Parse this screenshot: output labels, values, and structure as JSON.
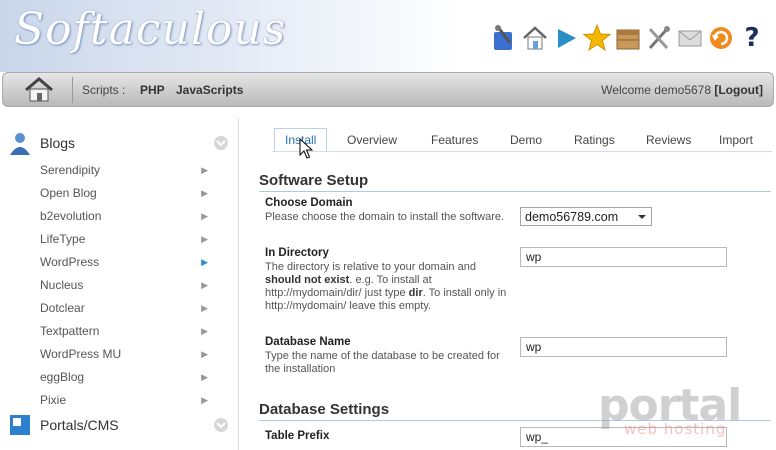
{
  "header": {
    "logo_text": "Softaculous",
    "toolbar_icons": [
      "tools-icon",
      "home-icon",
      "play-icon",
      "star-icon",
      "box-icon",
      "settings-icon",
      "mail-icon",
      "refresh-icon",
      "help-icon"
    ]
  },
  "navbar": {
    "scripts_label": "Scripts :",
    "links": [
      "PHP",
      "JavaScripts"
    ],
    "welcome_text": "Welcome demo5678",
    "logout_label": "[Logout]"
  },
  "sidebar": {
    "categories": [
      {
        "label": "Blogs",
        "icon": "user-icon"
      },
      {
        "label": "Portals/CMS",
        "icon": "portal-icon"
      }
    ],
    "items": [
      "Serendipity",
      "Open Blog",
      "b2evolution",
      "LifeType",
      "WordPress",
      "Nucleus",
      "Dotclear",
      "Textpattern",
      "WordPress MU",
      "eggBlog",
      "Pixie"
    ],
    "active_item": "WordPress"
  },
  "tabs": [
    "Install",
    "Overview",
    "Features",
    "Demo",
    "Ratings",
    "Reviews",
    "Import"
  ],
  "software_setup": {
    "title": "Software Setup",
    "choose_domain": {
      "label": "Choose Domain",
      "desc": "Please choose the domain to install the software.",
      "value": "demo56789.com"
    },
    "in_directory": {
      "label": "In Directory",
      "desc_1": "The directory is relative to your domain and ",
      "desc_bold_1": "should not exist",
      "desc_2": ". e.g. To install at http://mydomain/dir/ just type ",
      "desc_bold_2": "dir",
      "desc_3": ". To install only in http://mydomain/ leave this empty.",
      "value": "wp"
    },
    "database_name": {
      "label": "Database Name",
      "desc": "Type the name of the database to be created for the installation",
      "value": "wp"
    }
  },
  "database_settings": {
    "title": "Database Settings",
    "table_prefix": {
      "label": "Table Prefix",
      "value": "wp_"
    }
  },
  "watermark": {
    "main": "portal",
    "sub": "web hosting"
  },
  "colors": {
    "accent": "#2a6fb5",
    "nav_gradient_top": "#e6e6e6",
    "nav_gradient_bottom": "#b9b9b9"
  }
}
